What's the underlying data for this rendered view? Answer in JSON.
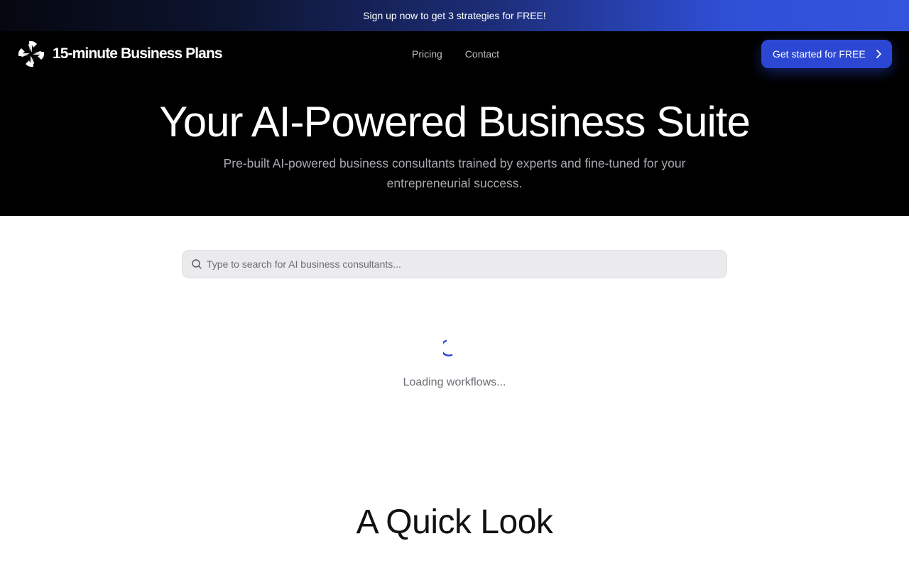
{
  "promo": {
    "text": "Sign up now to get 3 strategies for FREE!"
  },
  "header": {
    "logo_text": "15-minute Business Plans",
    "logo_icon": "pinwheel-logo-icon",
    "nav": [
      {
        "label": "Pricing"
      },
      {
        "label": "Contact"
      }
    ],
    "cta_label": "Get started for FREE",
    "cta_icon": "chevron-right-icon"
  },
  "hero": {
    "title": "Your AI-Powered Business Suite",
    "subtitle": "Pre-built AI-powered business consultants trained by experts and fine-tuned for your entrepreneurial success."
  },
  "search": {
    "placeholder": "Type to search for AI business consultants...",
    "value": "",
    "icon": "search-icon"
  },
  "loading": {
    "text": "Loading workflows...",
    "icon": "spinner-icon"
  },
  "quick_look": {
    "title": "A Quick Look"
  },
  "colors": {
    "accent": "#2c47d4",
    "header_bg": "#000000",
    "promo_gradient_end": "#3454dc"
  }
}
